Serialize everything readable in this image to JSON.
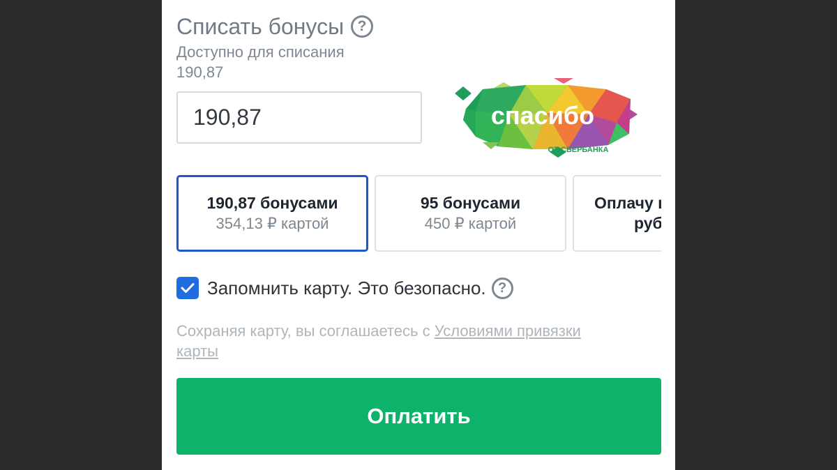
{
  "bonus_section": {
    "title": "Списать бонусы",
    "available_label": "Доступно для списания",
    "available_value": "190,87",
    "input_value": "190,87"
  },
  "logo": {
    "main_text": "спасибо",
    "sub_text": "ОТ СБЕРБАНКА"
  },
  "payment_options": [
    {
      "main": "190,87 бонусами",
      "sub": "354,13 ₽  картой",
      "selected": true
    },
    {
      "main": "95 бонусами",
      "sub": "450 ₽  картой",
      "selected": false
    },
    {
      "main": "Оплачу в",
      "sub": "руб",
      "selected": false
    }
  ],
  "remember_card": {
    "label": "Запомнить карту. Это безопасно.",
    "checked": true
  },
  "terms": {
    "text": "Сохраняя карту, вы соглашаетесь с ",
    "link_text": "Условиями привязки карты"
  },
  "pay_button": {
    "label": "Оплатить"
  },
  "colors": {
    "accent_blue": "#1f57c3",
    "checkbox_blue": "#1f6dde",
    "pay_green": "#0db26b"
  },
  "icons": {
    "help": "question-circle-icon",
    "check": "checkmark-icon"
  }
}
